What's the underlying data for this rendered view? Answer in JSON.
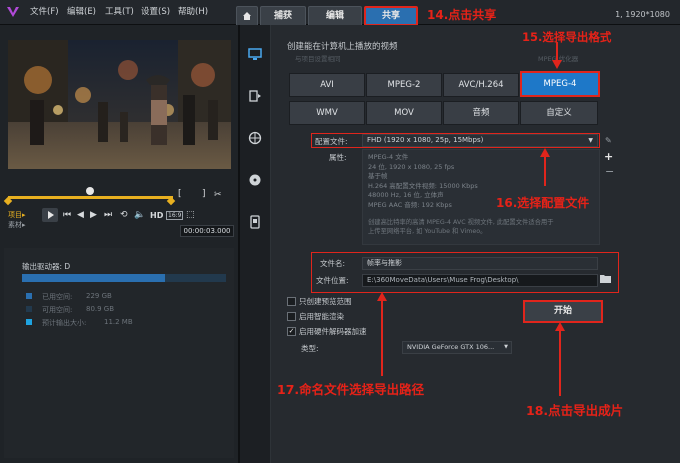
{
  "menu": {
    "file": "文件(F)",
    "edit": "编辑(E)",
    "tools": "工具(T)",
    "settings": "设置(S)",
    "help": "帮助(H)"
  },
  "tabs": {
    "capture": "捕获",
    "edit": "编辑",
    "share": "共享"
  },
  "resolution": "1, 1920*1080",
  "annotations": {
    "step14": "14.点击共享",
    "step15": "15.选择导出格式",
    "step16": "16.选择配置文件",
    "step17": "17.命名文件选择导出路径",
    "step18": "18.点击导出成片"
  },
  "player": {
    "project": "项目▸",
    "clip": "素材▸",
    "timecode": "00:00:03.000",
    "hd": "HD",
    "ratio": "16:9",
    "bracket_in": "[",
    "bracket_out": "]"
  },
  "output_panel": {
    "drive_label": "输出驱动器: D",
    "used_label": "已用空间:",
    "used_value": "229 GB",
    "free_label": "可用空间:",
    "free_value": "80.9 GB",
    "est_label": "预计输出大小:",
    "est_value": "11.2 MB",
    "used_fraction": 0.7,
    "used_color": "#2a6fb0",
    "free_color": "#22394d",
    "est_color": "#1fa3e0"
  },
  "share": {
    "header": "创建能在计算机上播放的视频",
    "faint_left": "与项目设置相同",
    "faint_right": "MPEG 优化器",
    "formats_row1": [
      "AVI",
      "MPEG-2",
      "AVC/H.264",
      "MPEG-4"
    ],
    "formats_row2": [
      "WMV",
      "MOV",
      "音频",
      "自定义"
    ],
    "selected_format": "MPEG-4",
    "profile_label": "配置文件:",
    "profile_value": "FHD (1920 x 1080, 25p, 15Mbps)",
    "props_label": "属性:",
    "props": [
      "MPEG-4 文件",
      "24 位, 1920 x 1080, 25 fps",
      "基于帧",
      "H.264 高配置文件视频: 15000 Kbps",
      "48000 Hz, 16 位, 立体声",
      "MPEG AAC 音频: 192 Kbps"
    ],
    "desc_line1": "创建高比特率的高清 MPEG-4 AVC 视频文件, 此配置文件适合用于",
    "desc_line2": "上传至网络平台, 如 YouTube 和 Vimeo。",
    "filename_label": "文件名:",
    "filename_value": "帧率与拖影",
    "location_label": "文件位置:",
    "location_value": "E:\\360MoveData\\Users\\Muse Frog\\Desktop\\",
    "start_label": "开始",
    "opt1": "只创建预览范围",
    "opt2": "启用智能渲染",
    "opt3": "启用硬件解码器加速",
    "type_label": "类型:",
    "type_value": "NVIDIA GeForce GTX 106...",
    "opt3_checked": true
  },
  "icons": {
    "monitor": "monitor-icon",
    "device": "device-icon",
    "web": "globe-icon",
    "disc": "disc-icon",
    "mobile": "mobile-icon"
  }
}
